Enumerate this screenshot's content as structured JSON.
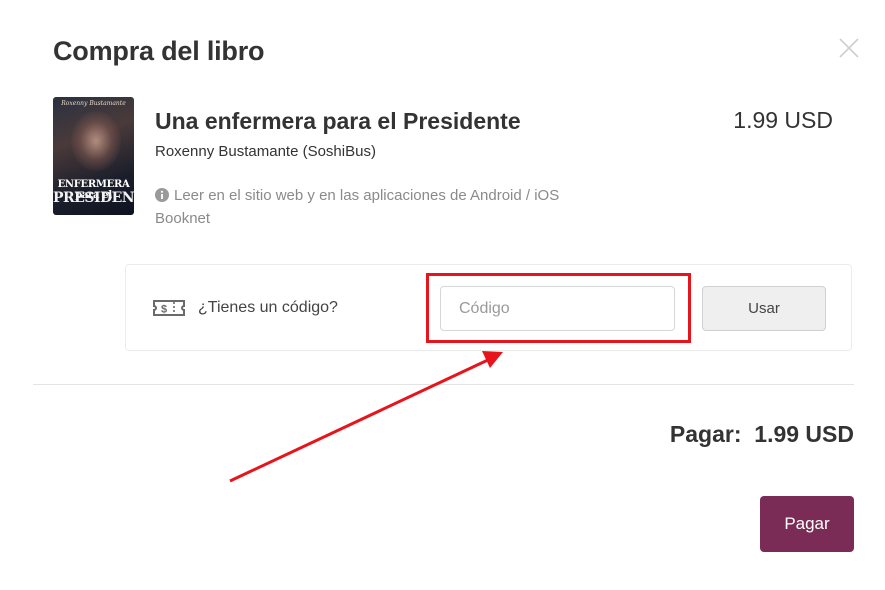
{
  "modal": {
    "title": "Compra del libro"
  },
  "book": {
    "cover_author": "Roxenny Bustamante",
    "cover_title_line1": "ENFERMERA para el",
    "cover_title_line2": "PRESIDENTE",
    "title": "Una enfermera para el Presidente",
    "author": "Roxenny Bustamante (SoshiBus)",
    "note": "Leer en el sitio web y en las aplicaciones de Android / iOS Booknet",
    "price": "1.99 USD"
  },
  "promo": {
    "label": "¿Tienes un código?",
    "input_placeholder": "Código",
    "input_value": "",
    "use_button_label": "Usar"
  },
  "payment": {
    "total_label": "Pagar:",
    "total_value": "1.99 USD",
    "pay_button_label": "Pagar"
  },
  "annotation": {
    "highlight_color": "#e8141c"
  },
  "colors": {
    "pay_button": "#7b2c56",
    "text": "#333333",
    "muted": "#8a8a8a"
  },
  "icons": {
    "close": "close-icon",
    "info": "info-icon",
    "ticket": "ticket-icon"
  }
}
